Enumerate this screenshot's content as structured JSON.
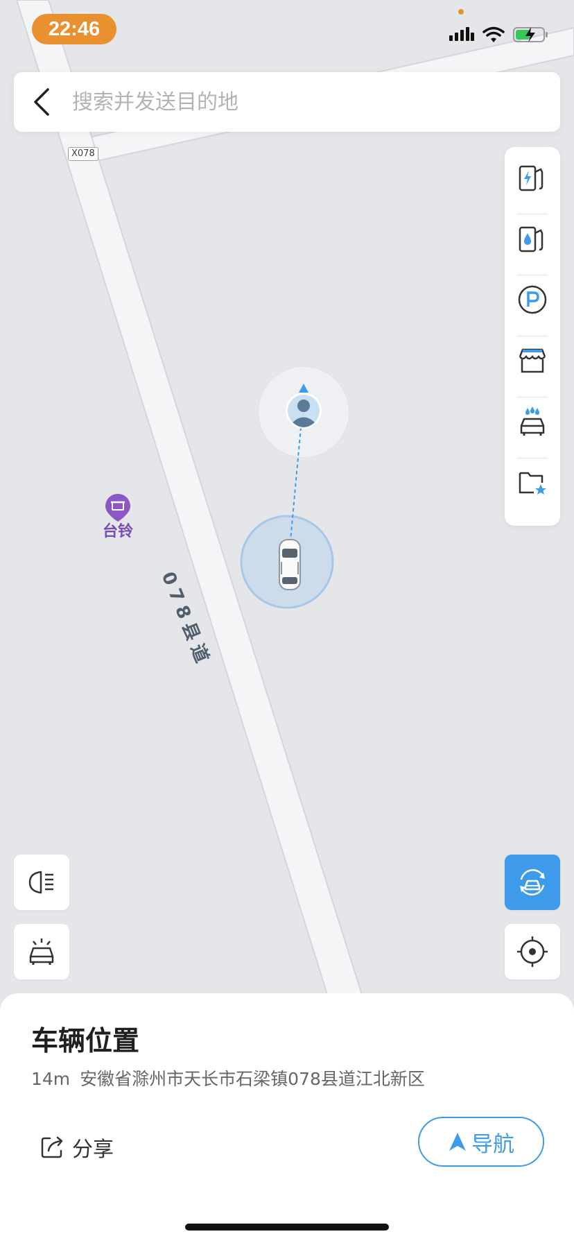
{
  "status_bar": {
    "time": "22:46"
  },
  "search": {
    "back_icon": "chevron-left-icon",
    "placeholder": "搜索并发送目的地"
  },
  "map": {
    "road_badge": "X078",
    "road_name": "078县道",
    "poi": {
      "name": "台铃",
      "icon": "store-pin-icon"
    }
  },
  "poi_panel": {
    "items": [
      {
        "icon": "charging-station-icon"
      },
      {
        "icon": "gas-station-icon"
      },
      {
        "icon": "parking-icon"
      },
      {
        "icon": "shop-icon"
      },
      {
        "icon": "car-wash-icon"
      },
      {
        "icon": "favorites-folder-icon"
      }
    ]
  },
  "floating_buttons": {
    "headlight": "headlight-icon",
    "car_alarm": "car-alarm-icon",
    "swap": "car-refresh-icon",
    "locate": "locate-icon"
  },
  "sheet": {
    "title": "车辆位置",
    "distance": "14m",
    "address": "安徽省滁州市天长市石梁镇078县道江北新区",
    "share_label": "分享",
    "nav_label": "导航"
  },
  "colors": {
    "accent": "#3d9be9",
    "time_pill": "#e8912e",
    "poi": "#7a4bb3"
  }
}
